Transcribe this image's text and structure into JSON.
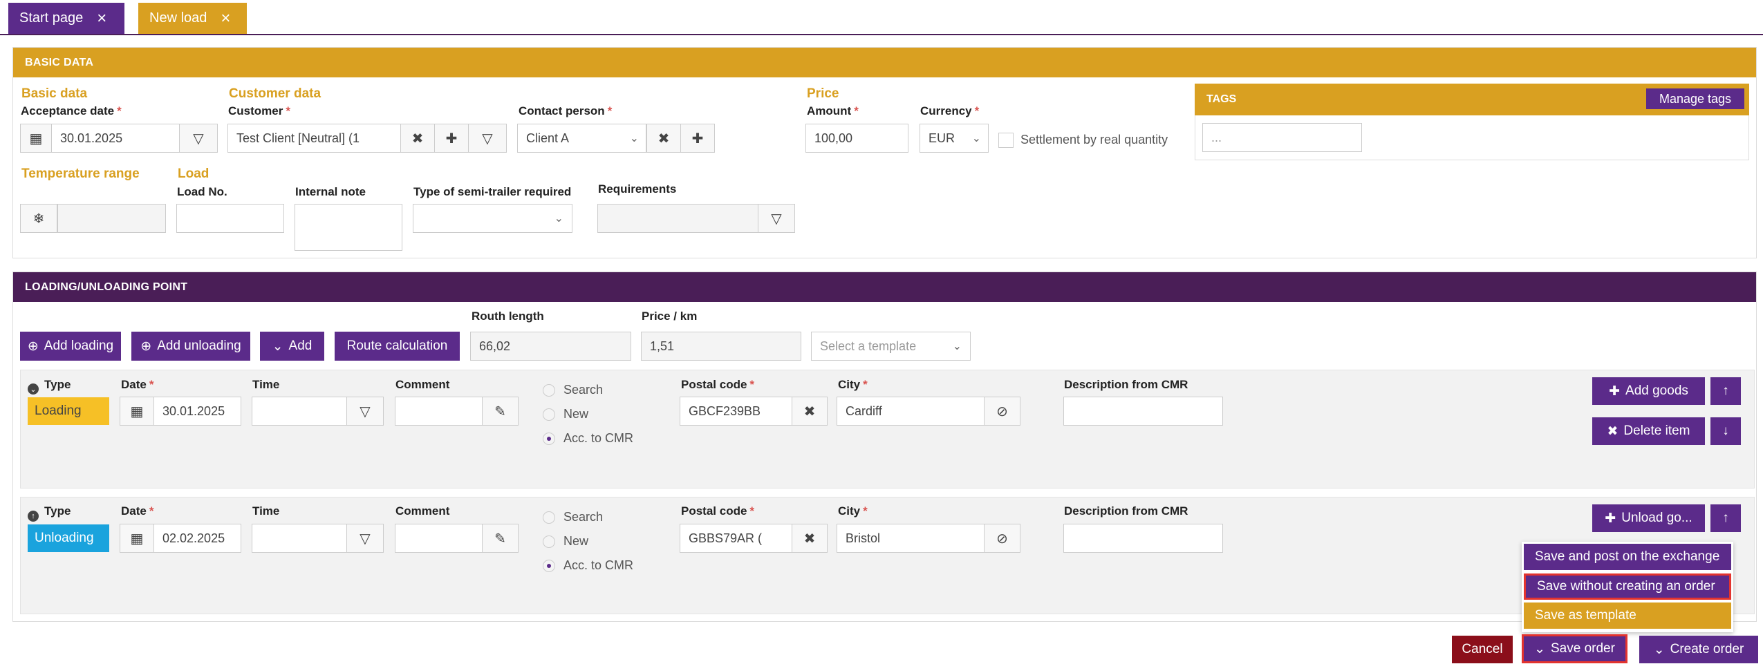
{
  "tabs": [
    {
      "label": "Start page"
    },
    {
      "label": "New load"
    }
  ],
  "icons": {
    "close": "×",
    "calendar": "▦",
    "filter": "▽",
    "clear": "✖",
    "plus": "✚",
    "chevron": "⌄",
    "snow": "❄",
    "edit": "✎",
    "compass": "⊘",
    "up": "↑",
    "down": "↓",
    "circle_plus": "⊕",
    "circle_down": "⊕",
    "check_down": "⌄"
  },
  "basic": {
    "header": "BASIC DATA",
    "basic_data_title": "Basic data",
    "acceptance_date_label": "Acceptance date",
    "acceptance_date_value": "30.01.2025",
    "customer_data_title": "Customer data",
    "customer_label": "Customer",
    "customer_value": "Test Client [Neutral] (1",
    "contact_label": "Contact person",
    "contact_value": "Client A",
    "price_title": "Price",
    "amount_label": "Amount",
    "amount_value": "100,00",
    "currency_label": "Currency",
    "currency_value": "EUR",
    "settlement_label": "Settlement by real quantity",
    "temp_title": "Temperature range",
    "load_title": "Load",
    "load_no_label": "Load No.",
    "internal_note_label": "Internal note",
    "semi_trailer_label": "Type of semi-trailer required",
    "requirements_label": "Requirements",
    "tags_header": "TAGS",
    "manage_tags": "Manage tags",
    "tags_placeholder": "..."
  },
  "points": {
    "header": "LOADING/UNLOADING POINT",
    "add_loading": "Add loading",
    "add_unloading": "Add unloading",
    "add": "Add",
    "route_calc": "Route calculation",
    "route_length_label": "Routh length",
    "route_length_value": "66,02",
    "price_km_label": "Price / km",
    "price_km_value": "1,51",
    "template_placeholder": "Select a template",
    "type_label": "Type",
    "date_label": "Date",
    "time_label": "Time",
    "comment_label": "Comment",
    "postal_label": "Postal code",
    "city_label": "City",
    "desc_label": "Description from CMR",
    "opt_search": "Search",
    "opt_new": "New",
    "opt_cmr": "Acc. to CMR",
    "loading": {
      "type": "Loading",
      "date": "30.01.2025",
      "postal": "GBCF239BB",
      "city": "Cardiff",
      "btn1": "Add goods",
      "btn2": "Delete item"
    },
    "unloading": {
      "type": "Unloading",
      "date": "02.02.2025",
      "postal": "GBBS79AR (",
      "city": "Bristol",
      "btn1": "Unload go..."
    }
  },
  "menu": [
    "Save and post on the exchange",
    "Save without creating an order",
    "Save as template"
  ],
  "footer": {
    "cancel": "Cancel",
    "save_order": "Save order",
    "create_order": "Create order"
  },
  "colors": {
    "purple": "#5b2b8a",
    "dark_purple": "#4a1e57",
    "gold": "#d9a021",
    "loading": "#f6c026",
    "unloading": "#1aa3dd",
    "cancel": "#8b0e1a"
  }
}
